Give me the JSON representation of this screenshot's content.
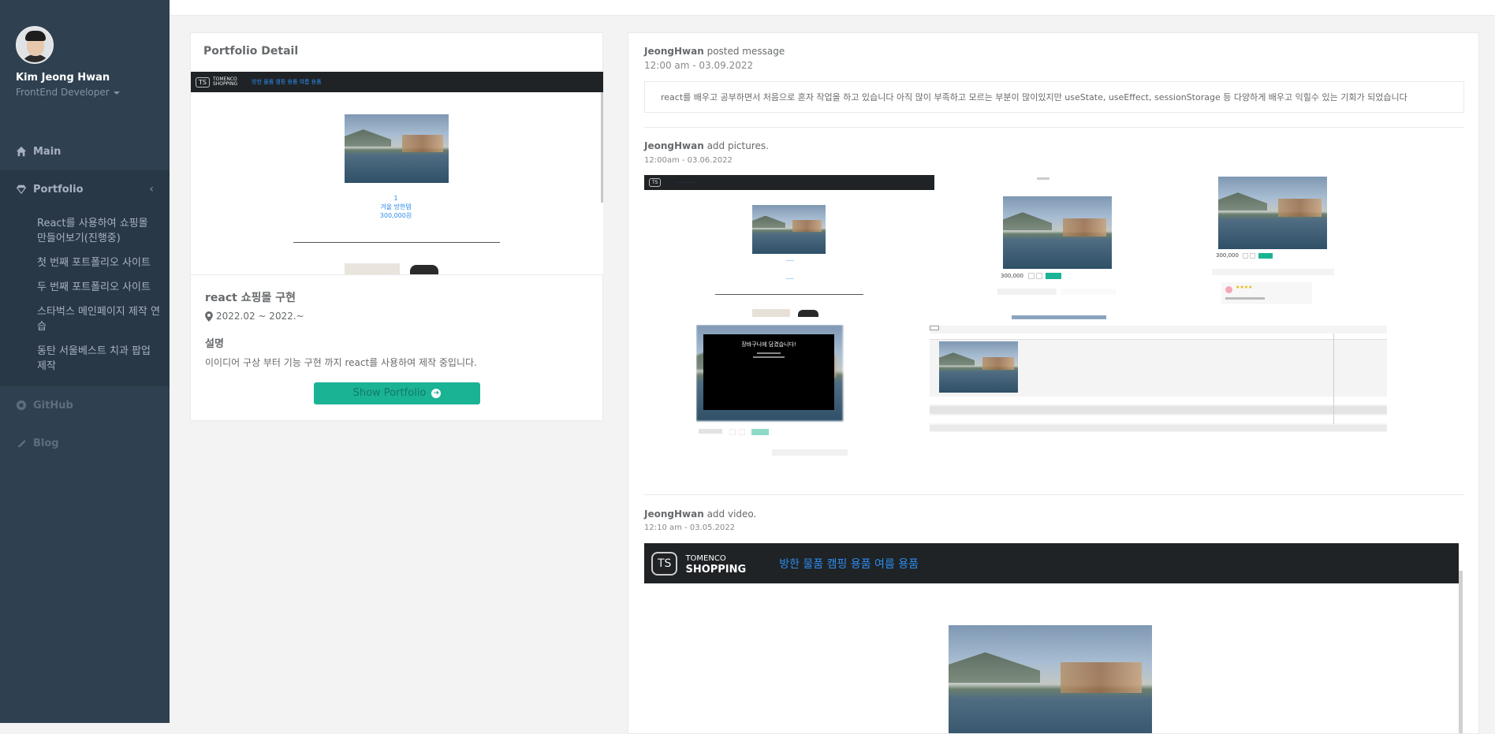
{
  "profile": {
    "name": "Kim Jeong Hwan",
    "role": "FrontEnd Developer"
  },
  "nav": {
    "main": "Main",
    "portfolio": "Portfolio",
    "sub": [
      "React를 사용하여 쇼핑몰 만들어보기(진행중)",
      "첫 번째 포트폴리오 사이트",
      "두 번째 포트폴리오 사이트",
      "스타벅스 메인페이지 제작 연습",
      "동탄 서울베스트 치과 팝업 제작"
    ],
    "github": "GitHub",
    "blog": "Blog"
  },
  "detail": {
    "title": "Portfolio Detail",
    "project": "react 쇼핑몰 구현",
    "period": "2022.02 ~ 2022.~",
    "desc_label": "설명",
    "desc": "이이디어 구상 부터 기능 구현 까지 react를 사용하여 제작 중입니다.",
    "button": "Show Portfolio",
    "preview": {
      "brand_top": "TOMENCO",
      "brand_bottom": "SHOPPING",
      "logo": "TS",
      "links": "방한 물품 캠핑 용품 여름 용품",
      "item_no": "1",
      "item_name": "겨울 방한템",
      "item_price": "300,000원"
    }
  },
  "feed": [
    {
      "user": "JeongHwan",
      "action": "posted message",
      "date": "12:00 am - 03.09.2022",
      "message": "react를 배우고 공부하면서 처음으로 혼자 작업을 하고 있습니다 아직 많이 부족하고 모르는 부분이 많이있지만 useState, useEffect, sessionStorage 등 다양하게 배우고 익힐수 있는 기회가 되었습니다"
    },
    {
      "user": "JeongHwan",
      "action": "add pictures.",
      "date": "12:00am - 03.06.2022",
      "modal_text": "장바구니에 담겼습니다!",
      "price": "300,000",
      "price2": "300,000"
    },
    {
      "user": "JeongHwan",
      "action": "add video.",
      "date": "12:10 am - 03.05.2022"
    }
  ],
  "video": {
    "logo": "TS",
    "brand_top": "TOMENCO",
    "brand_bottom": "SHOPPING",
    "links": "방한 물품 캠핑 용품 여름 용품"
  },
  "colors": {
    "sidebar": "#2f4050",
    "accent": "#1ab394",
    "link": "#2d8cf0"
  }
}
